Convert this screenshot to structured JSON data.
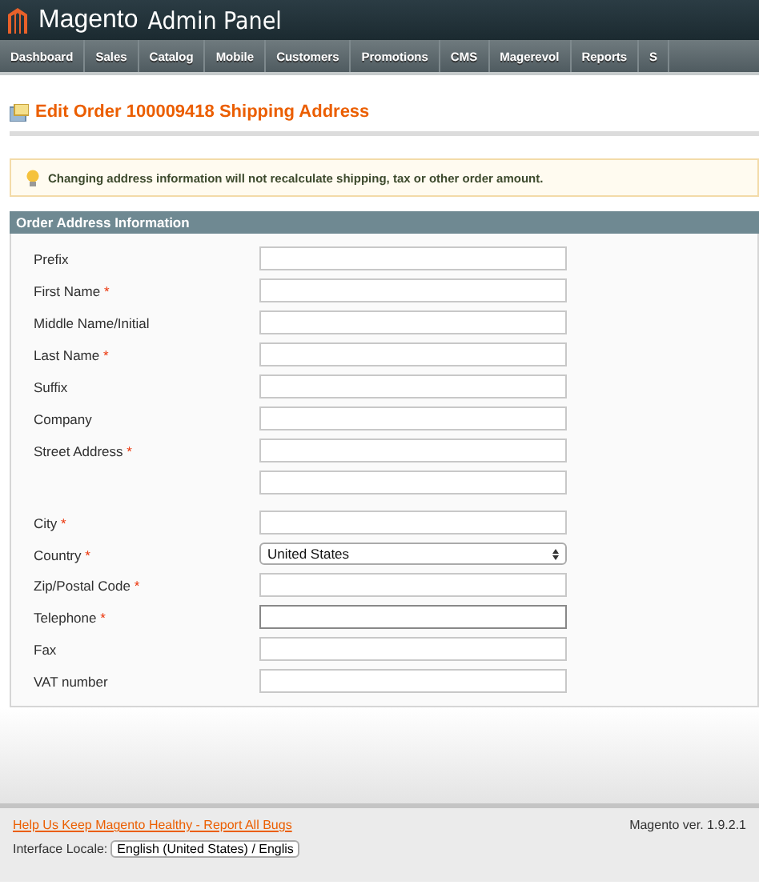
{
  "header": {
    "logo_text": "Magento",
    "title": "Admin Panel"
  },
  "nav": [
    "Dashboard",
    "Sales",
    "Catalog",
    "Mobile",
    "Customers",
    "Promotions",
    "CMS",
    "Magerevol",
    "Reports",
    "S"
  ],
  "page_title": "Edit Order 100009418 Shipping Address",
  "notice": "Changing address information will not recalculate shipping, tax or other order amount.",
  "section_title": "Order Address Information",
  "fields": [
    {
      "label": "Prefix",
      "kind": "text"
    },
    {
      "label": "First Name",
      "required_mark": "*",
      "kind": "text"
    },
    {
      "label": "Middle Name/Initial",
      "kind": "text"
    },
    {
      "label": "Last Name",
      "required_mark": "*",
      "kind": "text"
    },
    {
      "label": "Suffix",
      "kind": "text"
    },
    {
      "label": "Company",
      "kind": "text"
    },
    {
      "label": "Street Address",
      "required_mark": "*",
      "kind": "text",
      "second_line": true
    },
    {
      "label": "City",
      "required_mark": "*",
      "kind": "text"
    },
    {
      "label": "Country",
      "required_mark": "*",
      "kind": "select",
      "value": "United States"
    },
    {
      "label": "Zip/Postal Code",
      "required_mark": "*",
      "kind": "text"
    },
    {
      "label": "Telephone",
      "required_mark": "*",
      "kind": "text",
      "focused": true
    },
    {
      "label": "Fax",
      "kind": "text"
    },
    {
      "label": "VAT number",
      "kind": "text"
    }
  ],
  "footer": {
    "link": "Help Us Keep Magento Healthy - Report All Bugs",
    "version": "Magento ver. 1.9.2.1",
    "locale_label": "Interface Locale:",
    "locale_value": "English (United States) / Englis"
  }
}
